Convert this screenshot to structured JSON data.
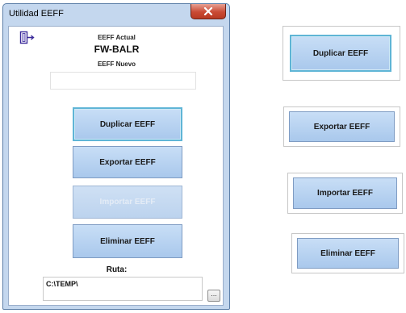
{
  "window": {
    "title": "Utilidad EEFF",
    "close_icon": "close-icon"
  },
  "header": {
    "actual_label": "EEFF Actual",
    "actual_value": "FW-BALR",
    "nuevo_label": "EEFF Nuevo",
    "nuevo_value": "",
    "icon": "door-exit-icon"
  },
  "actions": {
    "duplicar": "Duplicar EEFF",
    "exportar": "Exportar EEFF",
    "importar": "Importar EEFF",
    "eliminar": "Eliminar EEFF"
  },
  "ruta": {
    "label": "Ruta:",
    "value": "C:\\TEMP\\",
    "browse_label": "..."
  },
  "samples": {
    "duplicar": "Duplicar EEFF",
    "exportar": "Exportar EEFF",
    "importar": "Importar EEFF",
    "eliminar": "Eliminar EEFF"
  },
  "colors": {
    "button_fill": "#b8d3f0",
    "button_border": "#7f9cc3",
    "focus_border": "#5fb5d6",
    "window_frame": "#c4d7ee",
    "close_red": "#c94a34"
  }
}
